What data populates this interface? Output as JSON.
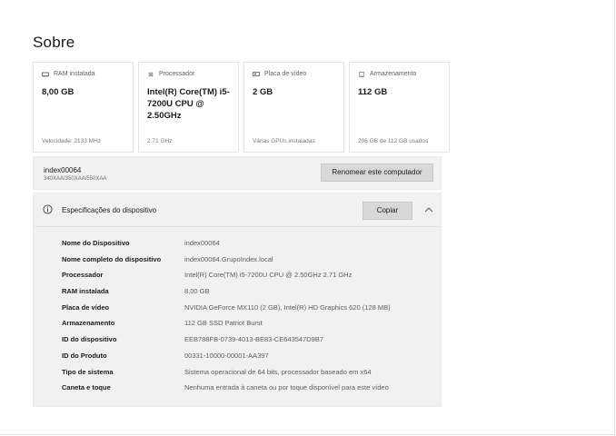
{
  "page": {
    "title": "Sobre"
  },
  "cards": [
    {
      "icon": "ram-icon",
      "label": "RAM instalada",
      "value": "8,00 GB",
      "sub": "Velocidade: 2133 MHz"
    },
    {
      "icon": "processor-icon",
      "label": "Processador",
      "value": "Intel(R) Core(TM) i5-7200U CPU @ 2.50GHz",
      "sub": "2.71 GHz"
    },
    {
      "icon": "graphics-card-icon",
      "label": "Placa de vídeo",
      "value": "2 GB",
      "sub": "Várias GPUs instaladas"
    },
    {
      "icon": "storage-icon",
      "label": "Armazenamento",
      "value": "112 GB",
      "sub": "206 GB de 112 GB usados"
    }
  ],
  "device": {
    "name": "index00064",
    "model": "340XAA/350XAA/550XAA",
    "rename_label": "Renomear este computador"
  },
  "specs": {
    "title": "Especificações do dispositivo",
    "copy_label": "Copiar",
    "rows": [
      {
        "label": "Nome do Dispositivo",
        "value": "index00064"
      },
      {
        "label": "Nome completo do dispositivo",
        "value": "index00064.GrupoIndex.local"
      },
      {
        "label": "Processador",
        "value": "Intel(R) Core(TM) i5-7200U CPU @ 2.50GHz   2.71 GHz"
      },
      {
        "label": "RAM instalada",
        "value": "8,00 GB"
      },
      {
        "label": "Placa de vídeo",
        "value": "NVIDIA GeForce MX110 (2 GB), Intel(R) HD Graphics 620 (128 MB)"
      },
      {
        "label": "Armazenamento",
        "value": "112 GB SSD Patriot Burst"
      },
      {
        "label": "ID do dispositivo",
        "value": "EEB788FB-0739-4013-BE83-CE643547D9B7"
      },
      {
        "label": "ID do Produto",
        "value": "00331-10000-00001-AA397"
      },
      {
        "label": "Tipo de sistema",
        "value": "Sistema operacional de 64 bits, processador baseado em x64"
      },
      {
        "label": "Caneta e toque",
        "value": "Nenhuma entrada à caneta ou por toque disponível para este vídeo"
      }
    ]
  }
}
